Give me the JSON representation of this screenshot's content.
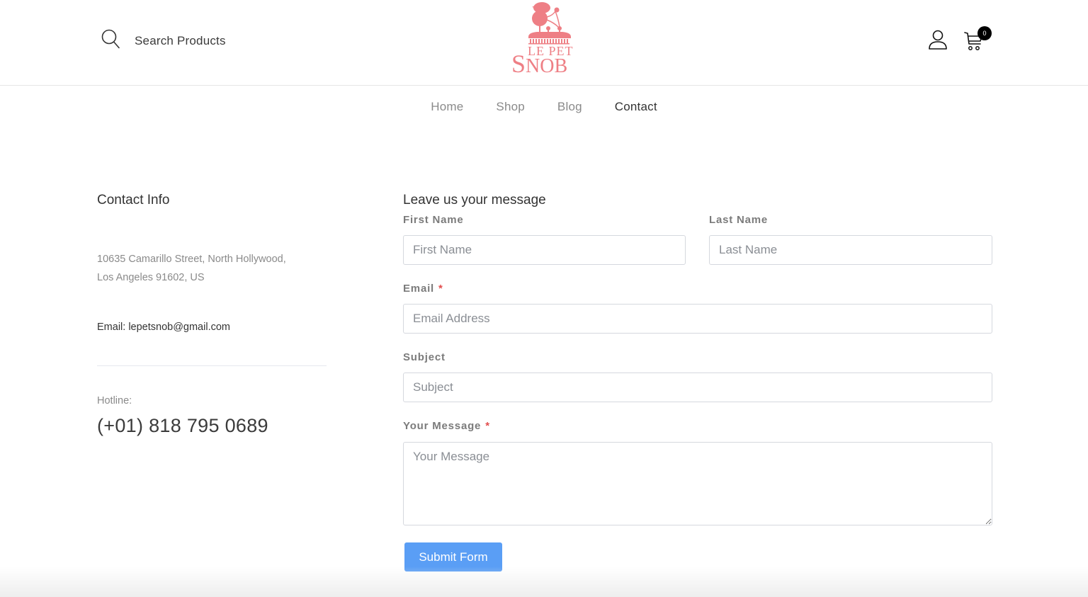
{
  "header": {
    "search_label": "Search Products",
    "logo": {
      "top_text": "LE PET",
      "main_text_big": "S",
      "main_text_rest": "NOB",
      "brand_color": "#ee7f85"
    },
    "icons": {
      "search": "search-icon",
      "account": "user-icon",
      "cart": "cart-icon"
    },
    "cart_count": "0"
  },
  "nav": {
    "items": [
      {
        "label": "Home",
        "active": false
      },
      {
        "label": "Shop",
        "active": false
      },
      {
        "label": "Blog",
        "active": false
      },
      {
        "label": "Contact",
        "active": true
      }
    ]
  },
  "contact_info": {
    "title": "Contact Info",
    "address_line1": "10635 Camarillo Street, North Hollywood,",
    "address_line2": "Los Angeles 91602, US",
    "email": "Email: lepetsnob@gmail.com",
    "hotline_label": "Hotline:",
    "phone": "(+01) 818 795 0689"
  },
  "form": {
    "title": "Leave us your message",
    "first_name": {
      "label": "First Name",
      "placeholder": "First Name",
      "value": ""
    },
    "last_name": {
      "label": "Last Name",
      "placeholder": "Last Name",
      "value": ""
    },
    "email": {
      "label": "Email",
      "required_mark": "*",
      "placeholder": "Email Address",
      "value": ""
    },
    "subject": {
      "label": "Subject",
      "placeholder": "Subject",
      "value": ""
    },
    "message": {
      "label": "Your Message",
      "required_mark": "*",
      "placeholder": "Your Message",
      "value": ""
    },
    "submit_label": "Submit Form",
    "accent_color": "#5a9ef5",
    "required_color": "#e24e4e"
  }
}
